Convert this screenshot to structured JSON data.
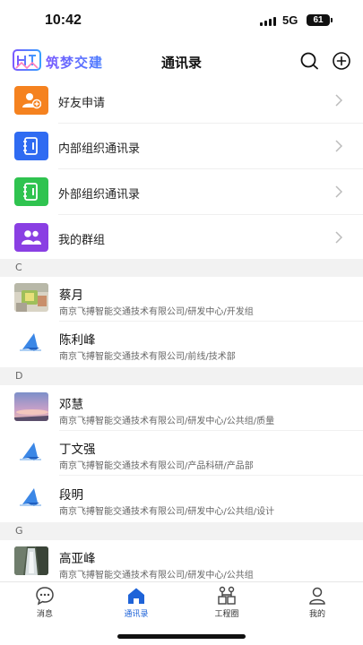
{
  "status_bar": {
    "time": "10:42",
    "network": "5G",
    "battery": "61"
  },
  "header": {
    "brand": "筑梦交建",
    "title": "通讯录"
  },
  "menu": [
    {
      "label": "好友申请",
      "icon": "person-add-icon",
      "color": "#f5821f"
    },
    {
      "label": "内部组织通讯录",
      "icon": "address-book-icon",
      "color": "#2f6bf2"
    },
    {
      "label": "外部组织通讯录",
      "icon": "address-book-icon",
      "color": "#2fc34f"
    },
    {
      "label": "我的群组",
      "icon": "group-icon",
      "color": "#8a3fe3"
    }
  ],
  "sections": [
    {
      "letter": "C",
      "contacts": [
        {
          "name": "蔡月",
          "org": "南京飞搏智能交通技术有限公司/研发中心/开发组",
          "avatar": "photo-avatar"
        },
        {
          "name": "陈利峰",
          "org": "南京飞搏智能交通技术有限公司/前线/技术部",
          "avatar": "logo-avatar"
        }
      ]
    },
    {
      "letter": "D",
      "contacts": [
        {
          "name": "邓慧",
          "org": "南京飞搏智能交通技术有限公司/研发中心/公共组/质量",
          "avatar": "sky-avatar"
        },
        {
          "name": "丁文强",
          "org": "南京飞搏智能交通技术有限公司/产品科研/产品部",
          "avatar": "logo-avatar"
        },
        {
          "name": "段明",
          "org": "南京飞搏智能交通技术有限公司/研发中心/公共组/设计",
          "avatar": "logo-avatar"
        }
      ]
    },
    {
      "letter": "G",
      "contacts": [
        {
          "name": "高亚峰",
          "org": "南京飞搏智能交通技术有限公司/研发中心/公共组",
          "avatar": "waterfall-avatar"
        }
      ]
    }
  ],
  "tabbar": [
    {
      "label": "消息",
      "icon": "message-icon"
    },
    {
      "label": "通讯录",
      "icon": "home-icon",
      "active": true
    },
    {
      "label": "工程圈",
      "icon": "project-circle-icon"
    },
    {
      "label": "我的",
      "icon": "profile-icon"
    }
  ],
  "colors": {
    "accent": "#1e63d8",
    "section_bg": "#f2f2f2"
  }
}
